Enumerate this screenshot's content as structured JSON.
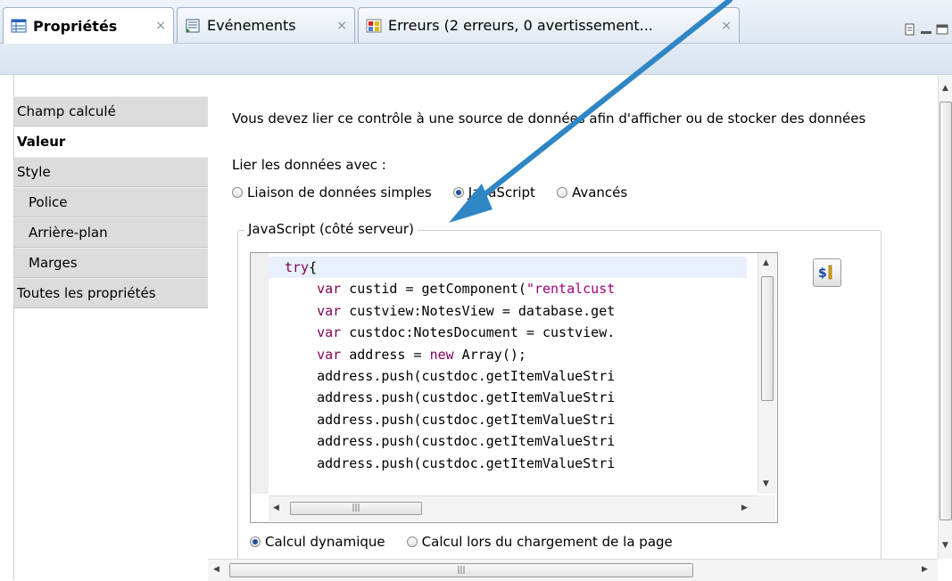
{
  "tabs": [
    {
      "label": "Propriétés",
      "close": "×",
      "icon": "properties-icon"
    },
    {
      "label": "Evénements",
      "close": "×",
      "icon": "events-icon"
    },
    {
      "label": "Erreurs (2 erreurs, 0 avertissement...",
      "close": "×",
      "icon": "errors-icon"
    }
  ],
  "nav": {
    "items": [
      {
        "label": "Champ calculé"
      },
      {
        "label": "Valeur"
      },
      {
        "label": "Style"
      },
      {
        "label": "Police"
      },
      {
        "label": "Arrière-plan"
      },
      {
        "label": "Marges"
      },
      {
        "label": "Toutes les propriétés"
      }
    ]
  },
  "content": {
    "message": "Vous devez lier ce contrôle à une source de données afin d'afficher ou de stocker des données",
    "bind_label": "Lier les données avec :",
    "bind_options": [
      {
        "label": "Liaison de données simples",
        "selected": false
      },
      {
        "label": "JavaScript",
        "selected": true
      },
      {
        "label": "Avancés",
        "selected": false
      }
    ],
    "group_label": "JavaScript (côté serveur)",
    "calc_options": [
      {
        "label": "Calcul dynamique",
        "selected": true
      },
      {
        "label": "Calcul lors du chargement de la page",
        "selected": false
      }
    ]
  },
  "code_lines": [
    "try{",
    "    var custid = getComponent(\"rentalcust",
    "    var custview:NotesView = database.get",
    "    var custdoc:NotesDocument = custview.",
    "    var address = new Array();",
    "    address.push(custdoc.getItemValueStri",
    "    address.push(custdoc.getItemValueStri",
    "    address.push(custdoc.getItemValueStri",
    "    address.push(custdoc.getItemValueStri",
    "    address.push(custdoc.getItemValueStri"
  ],
  "colors": {
    "keyword": "#7f0055",
    "string": "#a0007a",
    "arrow": "#2f86c4",
    "radio_on": "#1f4f9c"
  }
}
